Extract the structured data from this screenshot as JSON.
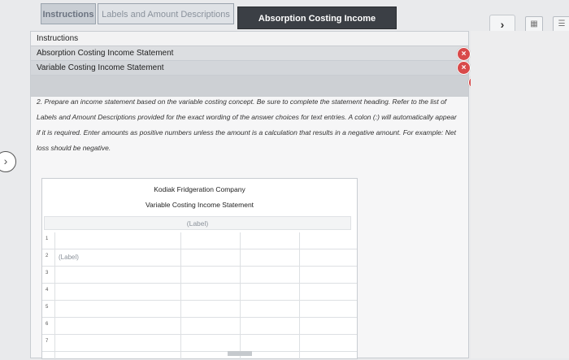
{
  "tabs": [
    {
      "label": "Instructions"
    },
    {
      "label": "Labels and Amount Descriptions"
    },
    {
      "label": "Absorption Costing Income Statement"
    }
  ],
  "toolbar": {
    "chevron": "›",
    "calc_icon": "calculator-icon",
    "menu_icon": "grid-icon"
  },
  "instructions_list": {
    "header": "Instructions",
    "items": [
      "Absorption Costing Income Statement",
      "Variable Costing Income Statement"
    ]
  },
  "question_text": "2. Prepare an income statement based on the variable costing concept. Be sure to complete the statement heading. Refer to the list of Labels and Amount Descriptions provided for the exact wording of the answer choices for text entries. A colon (:) will automatically appear if it is required. Enter amounts as positive numbers unless the amount is a calculation that results in a negative amount. For example: Net loss should be negative.",
  "sheet": {
    "company": "Kodiak Fridgeration Company",
    "statement": "Variable Costing Income Statement",
    "heading_label": "(Label)",
    "rows": [
      {
        "num": "1",
        "label": ""
      },
      {
        "num": "2",
        "label": "(Label)"
      },
      {
        "num": "3",
        "label": ""
      },
      {
        "num": "4",
        "label": ""
      },
      {
        "num": "5",
        "label": ""
      },
      {
        "num": "6",
        "label": ""
      },
      {
        "num": "7",
        "label": ""
      }
    ]
  },
  "accent": {
    "active_tab_bg": "#3b3f45",
    "close_red": "#d84a4a"
  }
}
